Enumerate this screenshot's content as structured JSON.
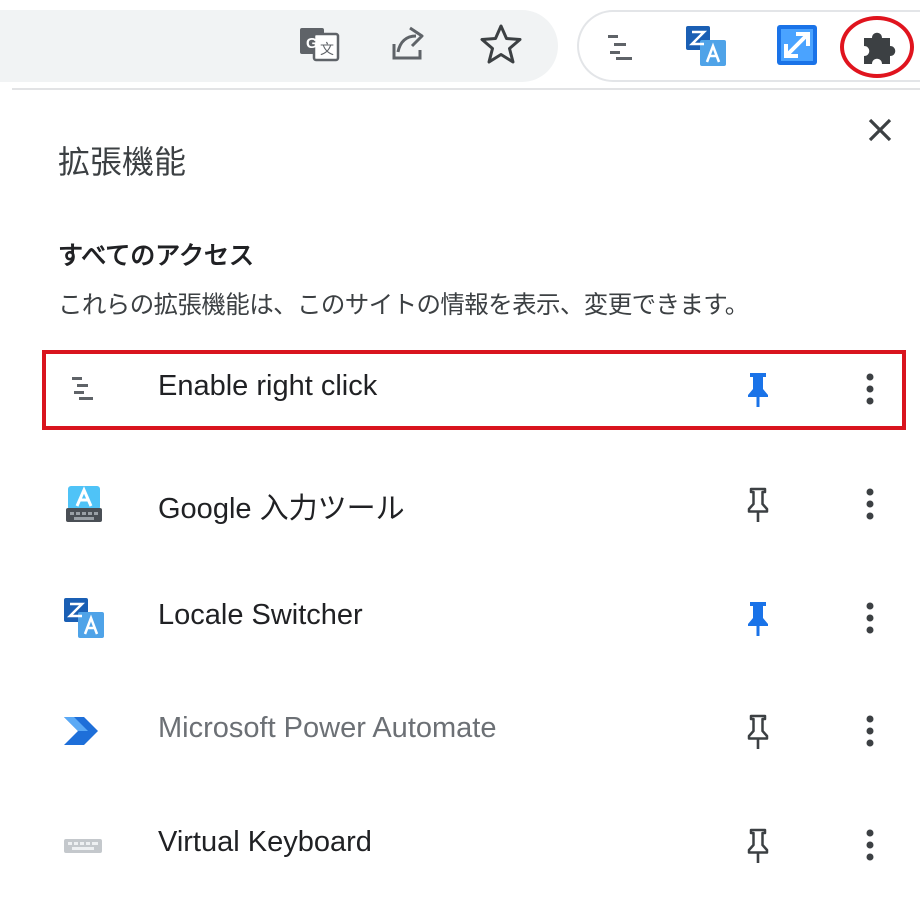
{
  "toolbar": {
    "icons": [
      "google-translate-icon",
      "share-icon",
      "bookmark-star-icon",
      "enable-right-click-icon",
      "locale-switcher-icon",
      "resize-icon",
      "extensions-puzzle-icon"
    ]
  },
  "popup": {
    "title": "拡張機能",
    "close_icon": "close-icon",
    "section": {
      "heading": "すべてのアクセス",
      "description": "これらの拡張機能は、このサイトの情報を表示、変更できます。"
    },
    "extensions": [
      {
        "name": "Enable right click",
        "icon": "enable-right-click-icon",
        "pinned": true,
        "dimmed": false
      },
      {
        "name": "Google 入力ツール",
        "icon": "google-input-tools-icon",
        "pinned": false,
        "dimmed": false
      },
      {
        "name": "Locale Switcher",
        "icon": "locale-switcher-icon",
        "pinned": true,
        "dimmed": false
      },
      {
        "name": "Microsoft Power Automate",
        "icon": "power-automate-icon",
        "pinned": false,
        "dimmed": true
      },
      {
        "name": "Virtual Keyboard",
        "icon": "virtual-keyboard-icon",
        "pinned": false,
        "dimmed": false
      }
    ]
  },
  "colors": {
    "pin_active": "#1a73e8",
    "pin_inactive": "#3c4043",
    "annotation_red": "#e0141e"
  }
}
